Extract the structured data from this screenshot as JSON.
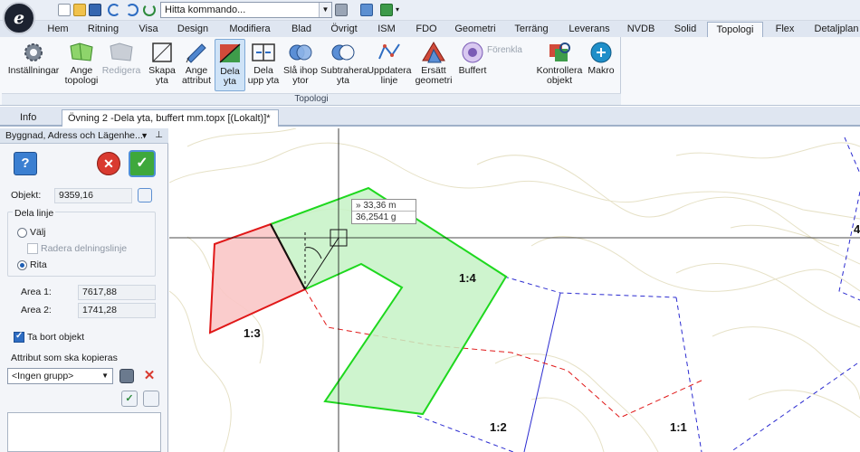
{
  "app": {
    "logo_letter": "e"
  },
  "quick_access": {
    "command_placeholder": "Hitta kommando...",
    "icons": [
      "new-file-icon",
      "open-folder-icon",
      "save-icon",
      "undo-icon",
      "redo-icon",
      "refresh-icon",
      "dropdown-arrow-icon"
    ]
  },
  "tabs": [
    "Hem",
    "Ritning",
    "Visa",
    "Design",
    "Modifiera",
    "Blad",
    "Övrigt",
    "ISM",
    "FDO",
    "Geometri",
    "Terräng",
    "Leverans",
    "NVDB",
    "Solid",
    "Topologi",
    "Flex",
    "Detaljplan"
  ],
  "active_tab": "Topologi",
  "ribbon": {
    "group_label": "Topologi",
    "forenkla_label": "Förenkla",
    "buttons": [
      {
        "id": "installningar",
        "line1": "Inställningar",
        "line2": ""
      },
      {
        "id": "ange-topologi",
        "line1": "Ange",
        "line2": "topologi"
      },
      {
        "id": "redigera",
        "line1": "Redigera",
        "line2": ""
      },
      {
        "id": "skapa-yta",
        "line1": "Skapa",
        "line2": "yta"
      },
      {
        "id": "ange-attribut",
        "line1": "Ange",
        "line2": "attribut"
      },
      {
        "id": "dela-yta",
        "line1": "Dela",
        "line2": "yta"
      },
      {
        "id": "dela-upp-yta",
        "line1": "Dela",
        "line2": "upp yta"
      },
      {
        "id": "sla-ihop-ytor",
        "line1": "Slå ihop",
        "line2": "ytor"
      },
      {
        "id": "subtrahera-yta",
        "line1": "Subtrahera",
        "line2": "yta"
      },
      {
        "id": "uppdatera-linje",
        "line1": "Uppdatera",
        "line2": "linje"
      },
      {
        "id": "ersatt-geometri",
        "line1": "Ersätt",
        "line2": "geometri"
      },
      {
        "id": "buffert",
        "line1": "Buffert",
        "line2": ""
      },
      {
        "id": "kontrollera-objekt",
        "line1": "Kontrollera",
        "line2": "objekt"
      },
      {
        "id": "makro",
        "line1": "Makro",
        "line2": ""
      }
    ]
  },
  "doc_tabs": {
    "info": "Info",
    "active_doc": "Övning 2 -Dela yta, buffert mm.topx [(Lokalt)]*",
    "close_symbol": "✕"
  },
  "panel": {
    "title": "Byggnad, Adress och Lägenhe...",
    "objekt_label": "Objekt:",
    "objekt_value": "9359,16",
    "dela_linje_label": "Dela linje",
    "valj_label": "Välj",
    "radera_label": "Radera delningslinje",
    "rita_label": "Rita",
    "area1_label": "Area 1:",
    "area1_value": "7617,88",
    "area2_label": "Area 2:",
    "area2_value": "1741,28",
    "ta_bort_label": "Ta bort objekt",
    "attribut_label": "Attribut som ska kopieras",
    "group_select": "<Ingen grupp>"
  },
  "map": {
    "tooltip_distance": "» 33,36 m",
    "tooltip_angle": "36,2541 g",
    "labels": [
      "1:4",
      "1:3",
      "1:2",
      "1:1",
      "4"
    ]
  },
  "colors": {
    "ribbon_bg": "#f6f8fb",
    "green_polygon_stroke": "#1ed81e",
    "green_polygon_fill": "#c6f2c6",
    "red_polygon_stroke": "#e01818",
    "red_polygon_fill": "#f9c6c6",
    "blue_dashed": "#2b2bd0",
    "contour": "#e6e1c6"
  }
}
